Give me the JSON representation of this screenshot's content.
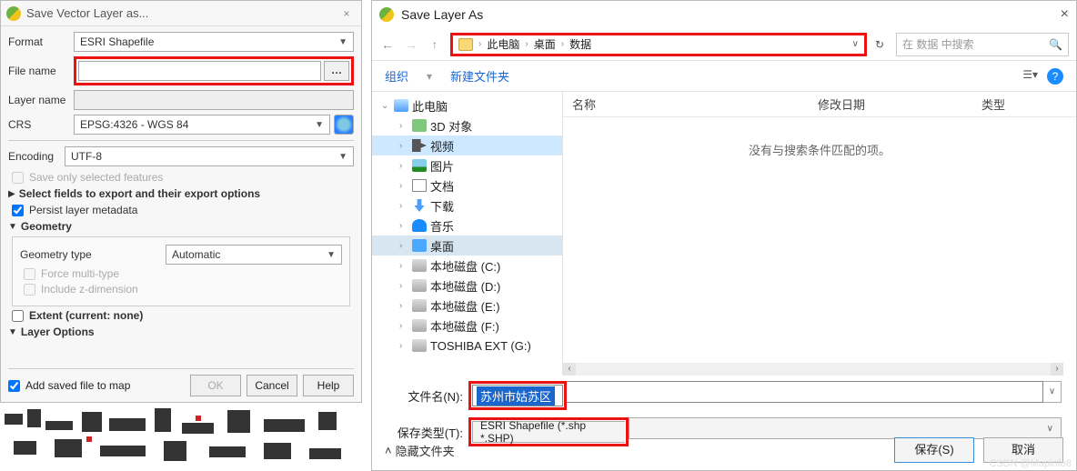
{
  "left": {
    "title": "Save Vector Layer as...",
    "labels": {
      "format": "Format",
      "filename": "File name",
      "layername": "Layer name",
      "crs": "CRS",
      "encoding": "Encoding"
    },
    "format_value": "ESRI Shapefile",
    "crs_value": "EPSG:4326 - WGS 84",
    "encoding_value": "UTF-8",
    "dots": "…",
    "save_only_selected": "Save only selected features",
    "select_fields_hdr": "Select fields to export and their export options",
    "persist_meta": "Persist layer metadata",
    "geometry_hdr": "Geometry",
    "geometry_type_lbl": "Geometry type",
    "geometry_type_val": "Automatic",
    "force_multi": "Force multi-type",
    "include_z": "Include z-dimension",
    "extent": "Extent (current: none)",
    "layer_options_hdr": "Layer Options",
    "add_to_map": "Add saved file to map",
    "ok": "OK",
    "cancel": "Cancel",
    "help": "Help"
  },
  "right": {
    "title": "Save Layer As",
    "crumbs": [
      "此电脑",
      "桌面",
      "数据"
    ],
    "search_placeholder": "在 数据 中搜索",
    "toolbar": {
      "organize": "组织",
      "newfolder": "新建文件夹"
    },
    "tree": {
      "pc": "此电脑",
      "items": [
        {
          "icon": "ico-3d",
          "label": "3D 对象"
        },
        {
          "icon": "ico-vid",
          "label": "视频",
          "sel": true
        },
        {
          "icon": "ico-img",
          "label": "图片"
        },
        {
          "icon": "ico-doc",
          "label": "文档"
        },
        {
          "icon": "ico-dl",
          "label": "下载"
        },
        {
          "icon": "ico-music",
          "label": "音乐"
        },
        {
          "icon": "ico-desk",
          "label": "桌面",
          "sel2": true
        },
        {
          "icon": "ico-disk",
          "label": "本地磁盘 (C:)"
        },
        {
          "icon": "ico-disk",
          "label": "本地磁盘 (D:)"
        },
        {
          "icon": "ico-disk",
          "label": "本地磁盘 (E:)"
        },
        {
          "icon": "ico-disk",
          "label": "本地磁盘 (F:)"
        },
        {
          "icon": "ico-disk",
          "label": "TOSHIBA EXT (G:)"
        }
      ]
    },
    "columns": {
      "name": "名称",
      "date": "修改日期",
      "type": "类型"
    },
    "empty": "没有与搜索条件匹配的项。",
    "filename_lbl": "文件名(N):",
    "filename_val": "苏州市姑苏区",
    "savetype_lbl": "保存类型(T):",
    "savetype_val": "ESRI Shapefile (*.shp *.SHP)",
    "hide_folders": "隐藏文件夹",
    "save_btn": "保存(S)",
    "cancel_btn": "取消"
  },
  "watermark": "CSDN @Mapinfo8"
}
